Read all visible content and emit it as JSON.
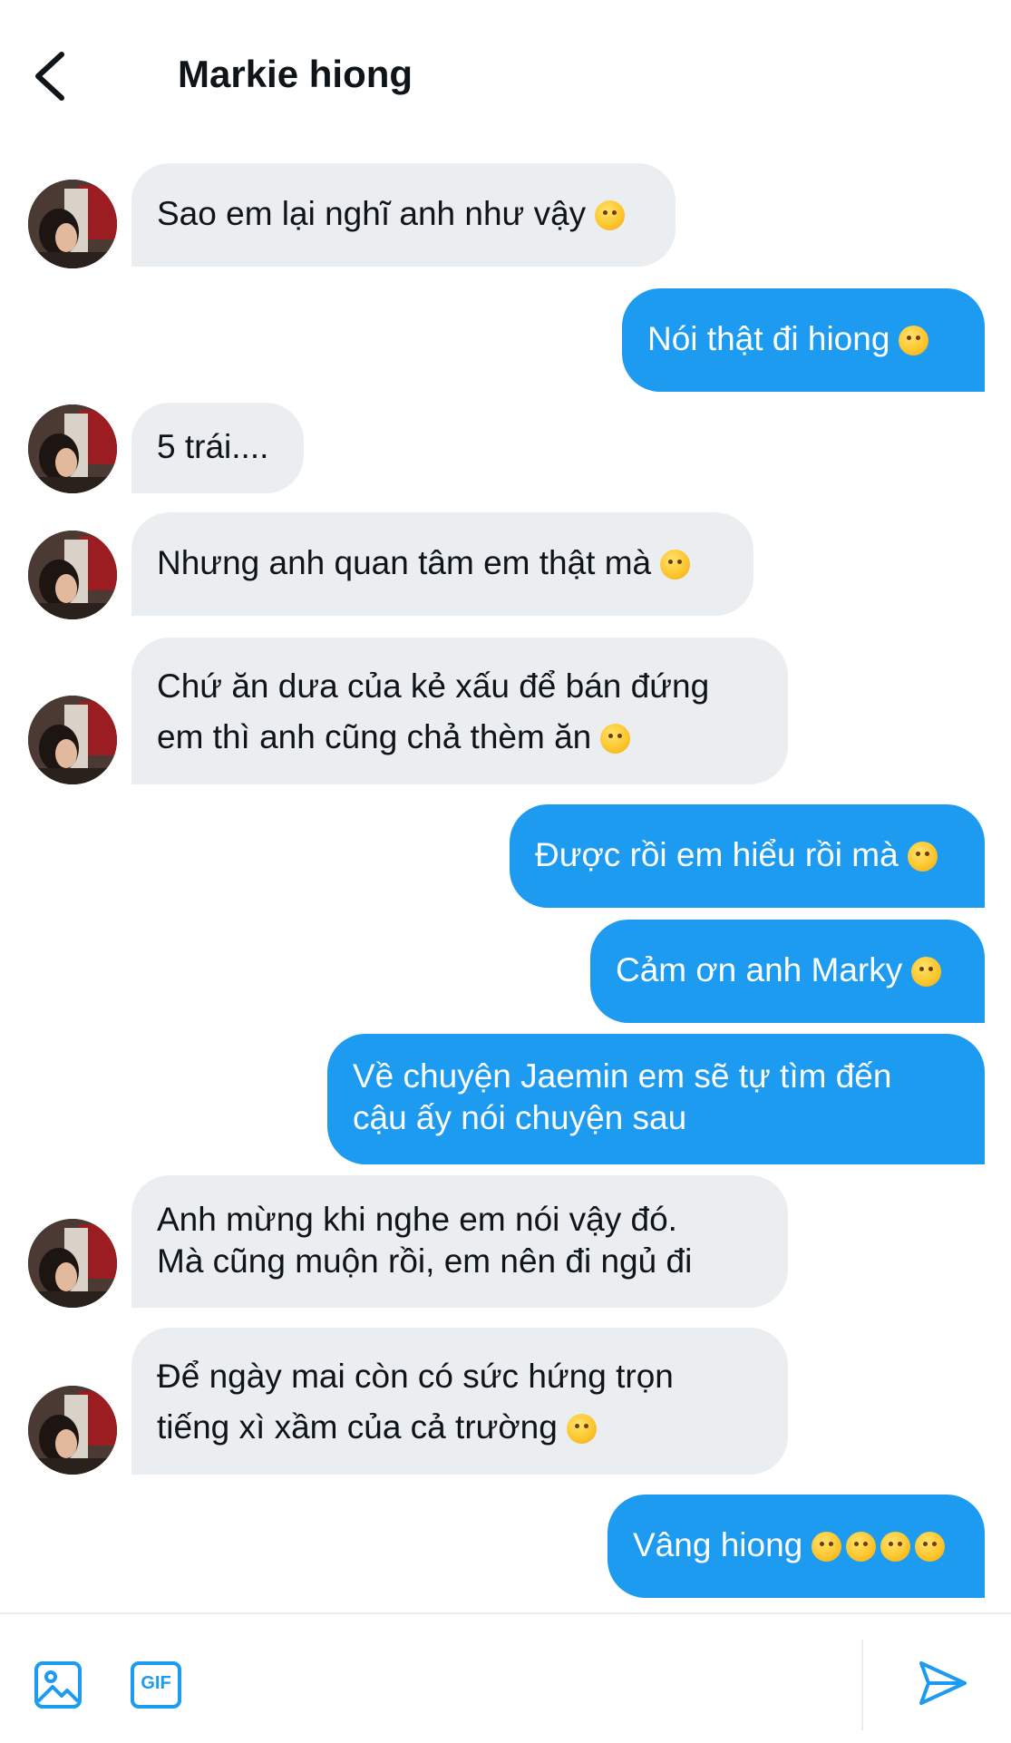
{
  "header": {
    "title": "Markie hiong",
    "back_icon": "chevron-left-icon"
  },
  "messages": [
    {
      "side": "in",
      "lines": [
        "Sao em lại nghĩ anh như vậy"
      ],
      "emoji": [
        "angry-face"
      ]
    },
    {
      "side": "out",
      "lines": [
        "Nói thật đi hiong"
      ],
      "emoji": [
        "unamused-face"
      ]
    },
    {
      "side": "in",
      "lines": [
        "5 trái...."
      ],
      "emoji": []
    },
    {
      "side": "in",
      "lines": [
        "Nhưng anh quan tâm em thật mà"
      ],
      "emoji": [
        "pleading-face"
      ]
    },
    {
      "side": "in",
      "lines": [
        "Chứ ăn dưa của kẻ xấu để bán đứng",
        "em thì anh cũng chả thèm ăn"
      ],
      "emoji": [
        "face-with-steam-from-nose"
      ]
    },
    {
      "side": "out",
      "lines": [
        "Được rồi em hiểu rồi mà"
      ],
      "emoji": [
        "face-with-tears-of-joy"
      ]
    },
    {
      "side": "out",
      "lines": [
        "Cảm ơn anh Marky"
      ],
      "emoji": [
        "smiling-face"
      ]
    },
    {
      "side": "out",
      "lines": [
        "Về chuyện Jaemin em sẽ tự tìm đến",
        "cậu ấy nói chuyện sau"
      ],
      "emoji": []
    },
    {
      "side": "in",
      "lines": [
        "Anh mừng khi nghe em nói vậy đó.",
        "Mà cũng muộn rồi, em nên đi ngủ đi"
      ],
      "emoji": []
    },
    {
      "side": "in",
      "lines": [
        "Để ngày mai còn có sức hứng trọn",
        "tiếng xì xầm của cả trường"
      ],
      "emoji": [
        "face-with-tears-of-joy"
      ]
    },
    {
      "side": "out",
      "lines": [
        "Vâng hiong"
      ],
      "emoji": [
        "confounded-face",
        "confounded-face",
        "confounded-face",
        "confounded-face"
      ]
    }
  ],
  "composer": {
    "image_icon": "image-icon",
    "gif_label": "GIF",
    "send_icon": "send-icon"
  },
  "colors": {
    "outgoing_bubble": "#1d9bf0",
    "incoming_bubble": "#ebeef0",
    "accent": "#1d9bf0"
  }
}
